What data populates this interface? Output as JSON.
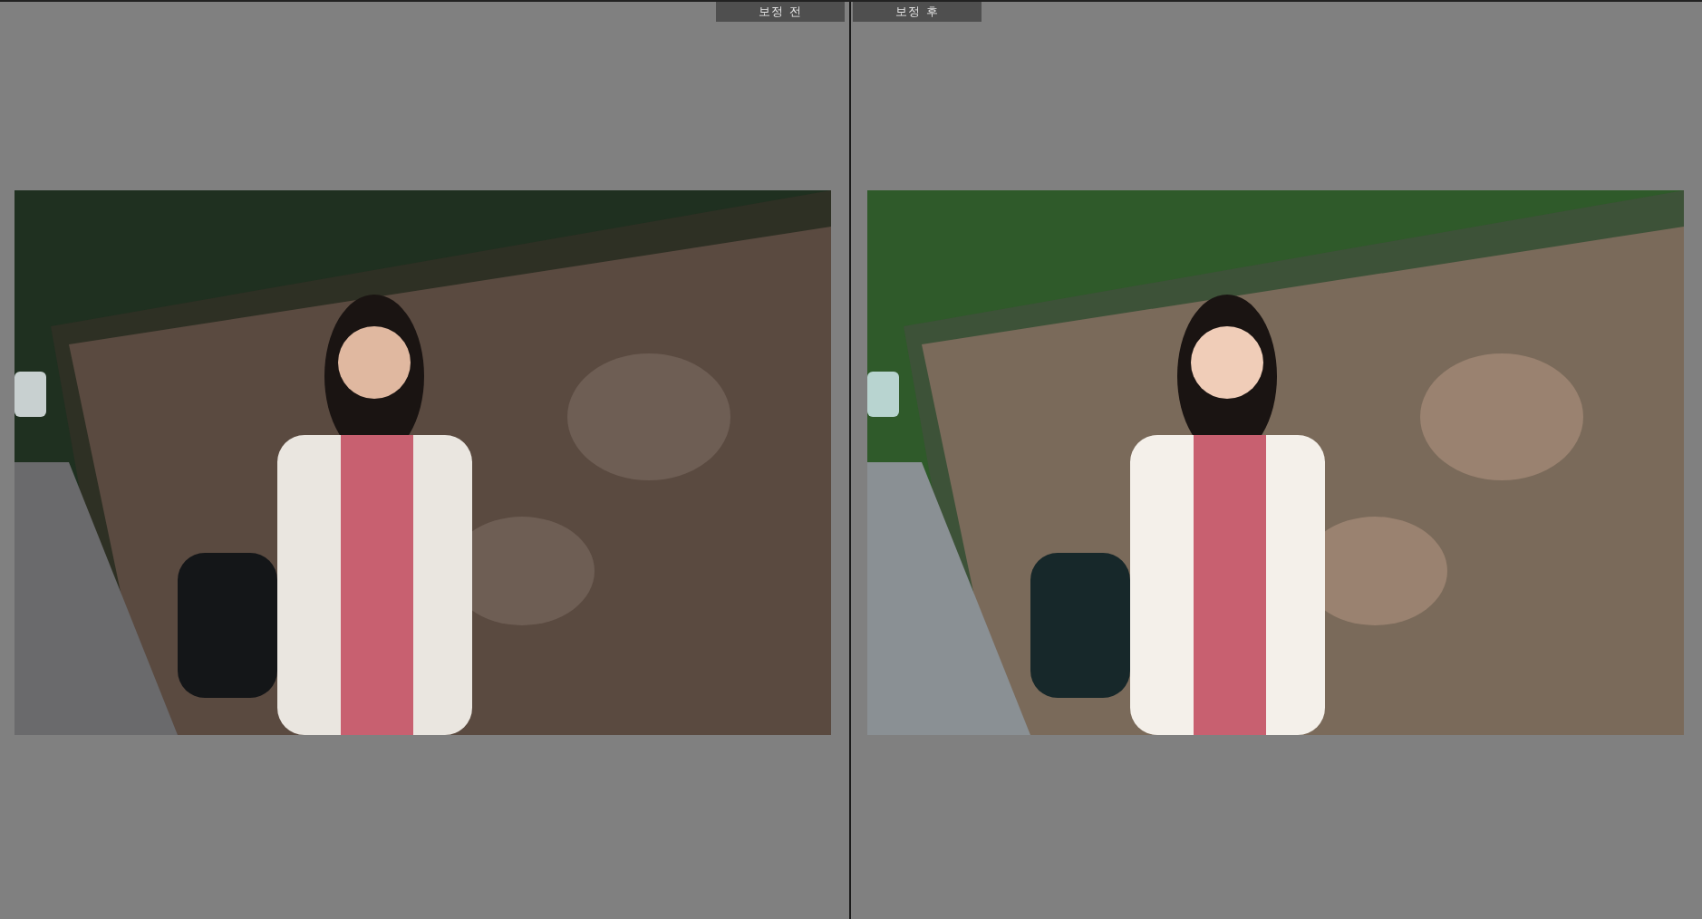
{
  "panels": [
    {
      "label": "보정 전"
    },
    {
      "label": "보정 후"
    }
  ]
}
